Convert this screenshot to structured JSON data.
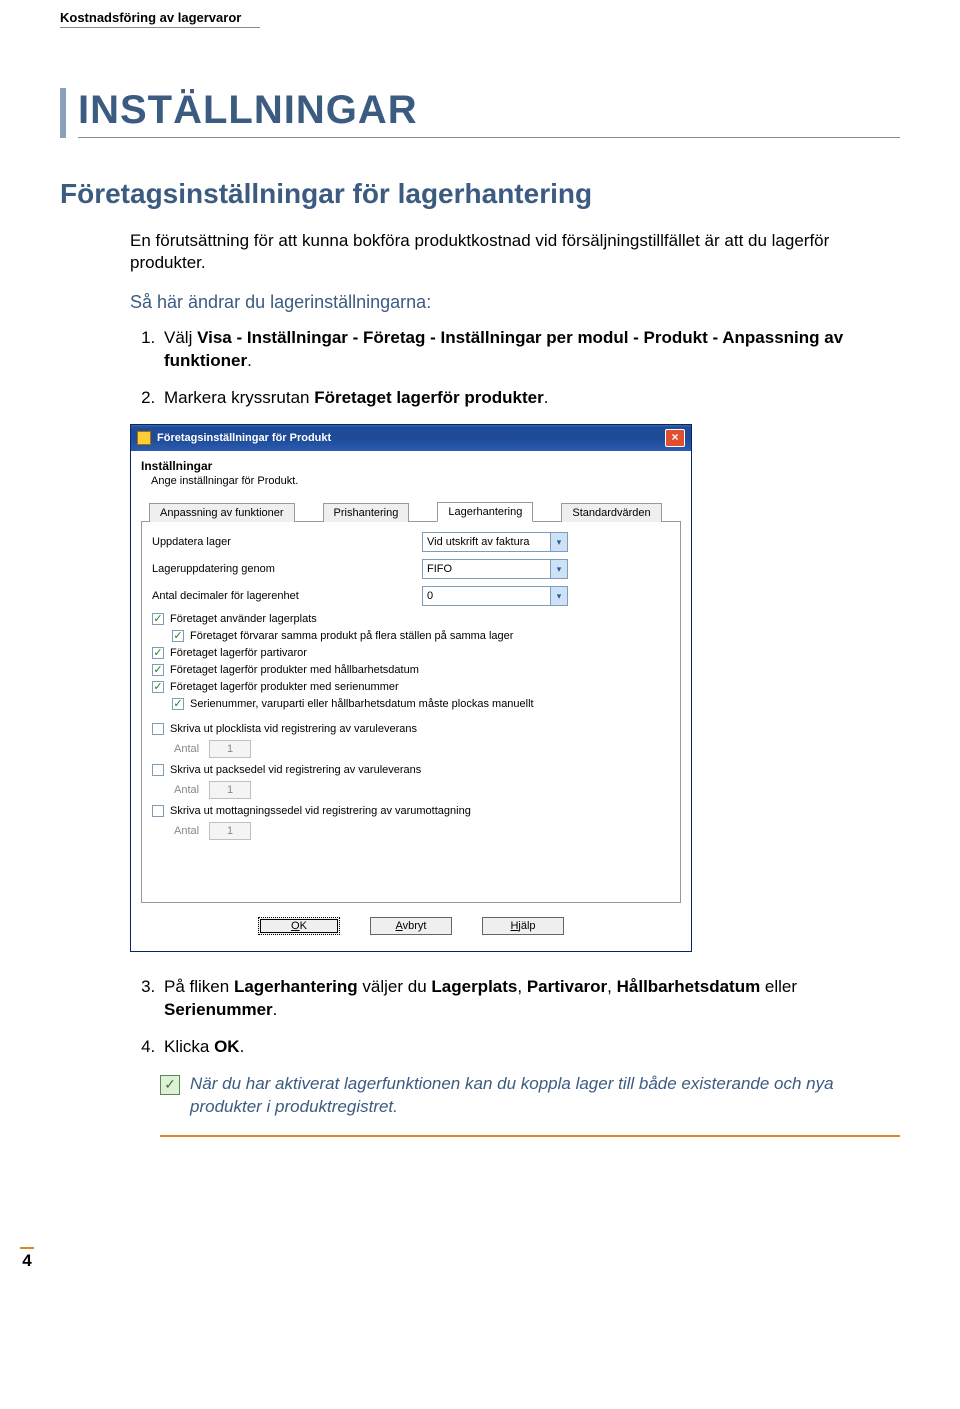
{
  "doc_header": "Kostnadsföring av lagervaror",
  "title": "INSTÄLLNINGAR",
  "section": "Företagsinställningar för lagerhantering",
  "intro": "En förutsättning för att kunna bokföra produktkostnad vid försäljningstillfället är att du lagerför produkter.",
  "sub_heading": "Så här ändrar du lagerinställningarna:",
  "steps": {
    "s1_pre": "Välj ",
    "s1_bold": "Visa - Inställningar - Företag - Inställningar per modul - Produkt - Anpassning av funktioner",
    "s1_post": ".",
    "s2_pre": "Markera kryssrutan ",
    "s2_bold": "Företaget lagerför produkter",
    "s2_post": ".",
    "s3_pre": "På fliken ",
    "s3_b1": "Lagerhantering",
    "s3_mid1": " väljer du ",
    "s3_b2": "Lagerplats",
    "s3_mid2": ", ",
    "s3_b3": "Partivaror",
    "s3_mid3": ", ",
    "s3_b4": "Hållbarhetsdatum",
    "s3_mid4": " eller ",
    "s3_b5": "Serienummer",
    "s3_post": ".",
    "s4_pre": "Klicka ",
    "s4_bold": "OK",
    "s4_post": "."
  },
  "dialog": {
    "title": "Företagsinställningar för Produkt",
    "close": "×",
    "heading": "Inställningar",
    "sub": "Ange inställningar för Produkt.",
    "tabs": [
      "Anpassning av funktioner",
      "Prishantering",
      "Lagerhantering",
      "Standardvärden"
    ],
    "rows": {
      "r1_label": "Uppdatera lager",
      "r1_value": "Vid utskrift av faktura",
      "r2_label": "Lageruppdatering genom",
      "r2_value": "FIFO",
      "r3_label": "Antal decimaler för lagerenhet",
      "r3_value": "0"
    },
    "checks": {
      "c1": "Företaget använder lagerplats",
      "c1a": "Företaget förvarar samma produkt på flera ställen på samma lager",
      "c2": "Företaget lagerför partivaror",
      "c3": "Företaget lagerför produkter med hållbarhetsdatum",
      "c4": "Företaget lagerför produkter med serienummer",
      "c4a": "Serienummer, varuparti eller hållbarhetsdatum måste plockas manuellt",
      "c5": "Skriva ut plocklista vid registrering av varuleverans",
      "c6": "Skriva ut packsedel vid registrering av varuleverans",
      "c7": "Skriva ut mottagningssedel vid registrering av varumottagning"
    },
    "antal_label": "Antal",
    "antal_value": "1",
    "buttons": {
      "ok": "OK",
      "cancel": "Avbryt",
      "help": "Hjälp"
    }
  },
  "note": "När du har aktiverat lagerfunktionen kan du koppla lager till både existerande och nya produkter i produktregistret.",
  "pagenum": "4"
}
